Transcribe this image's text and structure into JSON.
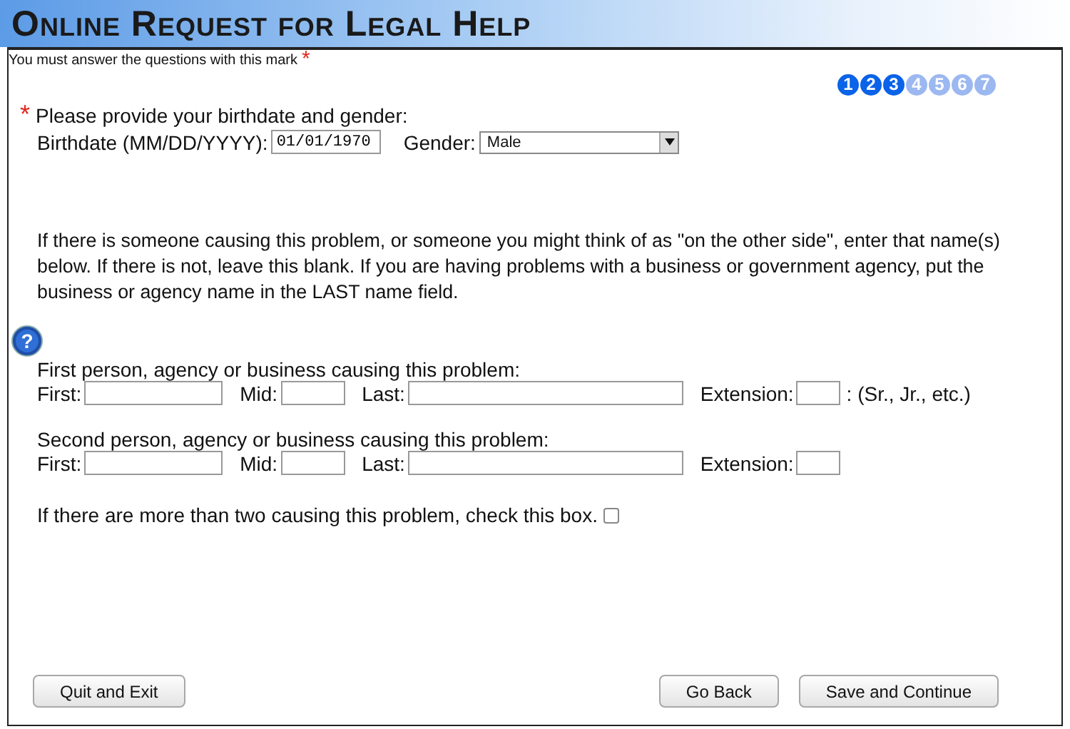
{
  "title": "Online Request for Legal Help",
  "required_note": {
    "text": "You must answer the questions with this mark",
    "mark": "*"
  },
  "steps": [
    {
      "label": "1",
      "completed": true
    },
    {
      "label": "2",
      "completed": true
    },
    {
      "label": "3",
      "completed": true
    },
    {
      "label": "4",
      "completed": false
    },
    {
      "label": "5",
      "completed": false
    },
    {
      "label": "6",
      "completed": false
    },
    {
      "label": "7",
      "completed": false
    }
  ],
  "birth_section": {
    "mark": "*",
    "prompt": "Please provide your birthdate and gender:",
    "birthdate_label": "Birthdate (MM/DD/YYYY):",
    "birthdate_value": "01/01/1970",
    "gender_label": "Gender:",
    "gender_value": "Male"
  },
  "instructions": "If there is someone causing this problem, or someone you might think of as \"on the other side\", enter that name(s) below. If there is not, leave this blank. If you are having problems with a business or government agency, put the business or agency name in the LAST name field.",
  "help_icon": "?",
  "persons": [
    {
      "heading": "First person, agency or business causing this problem:",
      "first_label": "First:",
      "mid_label": "Mid:",
      "last_label": "Last:",
      "extension_label": "Extension:",
      "extension_hint": ": (Sr., Jr., etc.)"
    },
    {
      "heading": "Second person, agency or business causing this problem:",
      "first_label": "First:",
      "mid_label": "Mid:",
      "last_label": "Last:",
      "extension_label": "Extension:"
    }
  ],
  "more_than_two": {
    "label": "If there are more than two causing this problem, check this box.",
    "checked": false
  },
  "buttons": [
    {
      "label": "Quit and Exit",
      "kind": "left"
    },
    {
      "label": "Go Back",
      "kind": "right"
    },
    {
      "label": "Save and Continue",
      "kind": "right"
    }
  ]
}
